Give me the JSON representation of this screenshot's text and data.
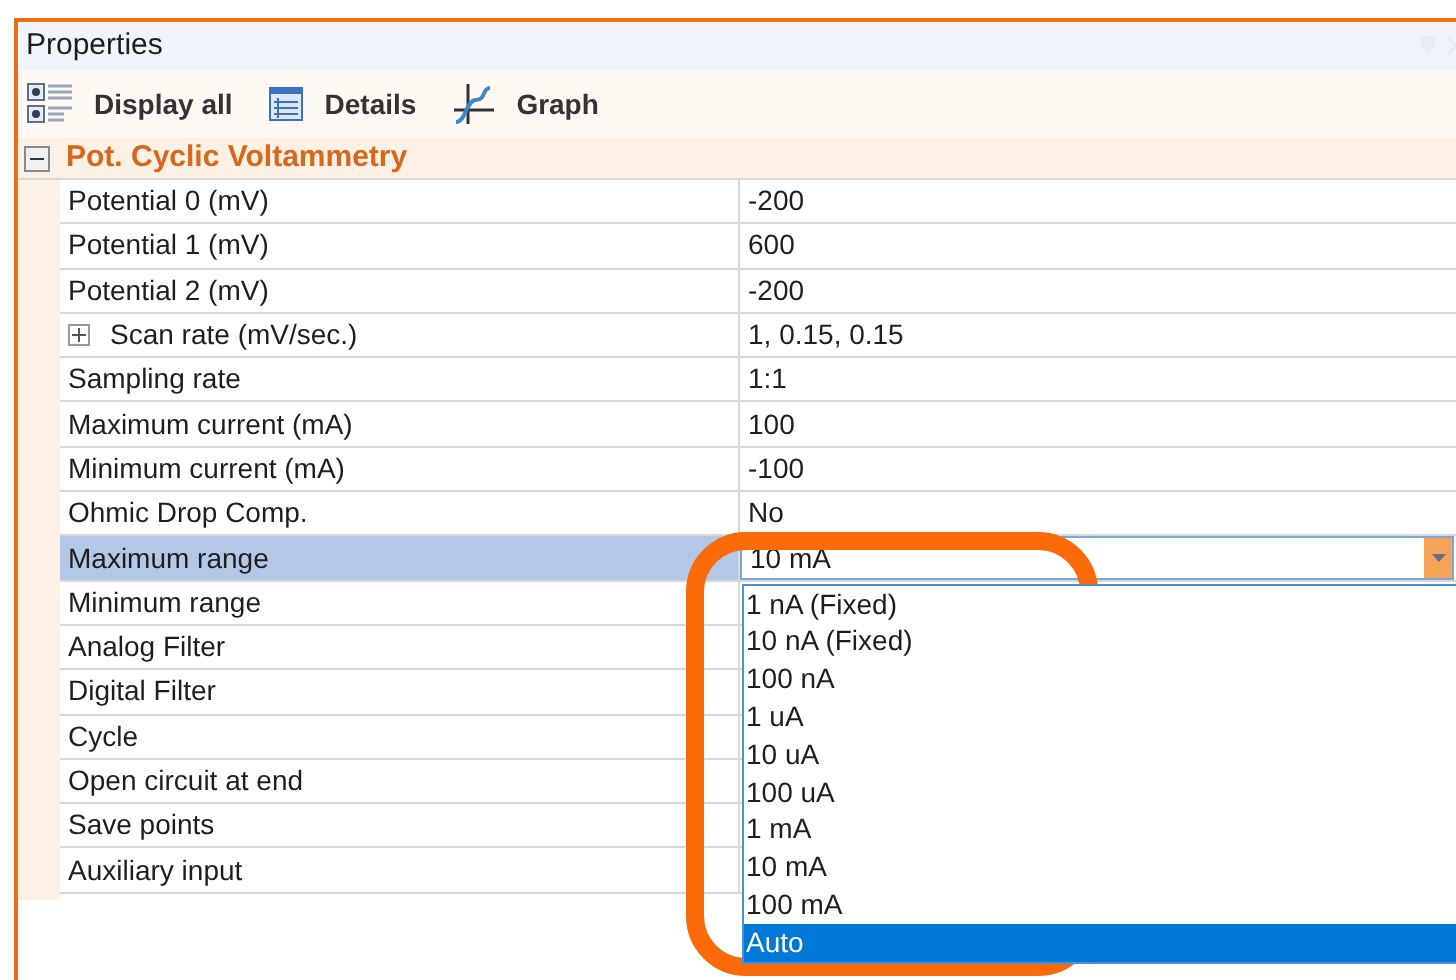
{
  "window": {
    "title": "Properties"
  },
  "toolbar": [
    {
      "label": "Display all",
      "kind": "display"
    },
    {
      "label": "Details",
      "kind": "details"
    },
    {
      "label": "Graph",
      "kind": "graph"
    }
  ],
  "group": {
    "title": "Pot. Cyclic Voltammetry",
    "expanded": true
  },
  "rows": [
    {
      "label": "Potential 0 (mV)",
      "value": "-200",
      "selected": false
    },
    {
      "label": "Potential 1 (mV)",
      "value": "600",
      "selected": false
    },
    {
      "label": "Potential 2 (mV)",
      "value": "-200",
      "selected": false
    },
    {
      "label": "Scan rate (mV/sec.)",
      "value": "1, 0.15, 0.15",
      "selected": false,
      "expandable": true
    },
    {
      "label": "Sampling rate",
      "value": "1:1",
      "selected": false
    },
    {
      "label": "Maximum current (mA)",
      "value": "100",
      "selected": false
    },
    {
      "label": "Minimum current (mA)",
      "value": "-100",
      "selected": false
    },
    {
      "label": "Ohmic Drop Comp.",
      "value": "No",
      "selected": false
    },
    {
      "label": "Maximum range",
      "value": "10 mA",
      "selected": true,
      "dropdown_open": true
    },
    {
      "label": "Minimum range",
      "selected": false
    },
    {
      "label": "Analog Filter",
      "selected": false
    },
    {
      "label": "Digital Filter",
      "selected": false
    },
    {
      "label": "Cycle",
      "selected": false
    },
    {
      "label": "Open circuit at end",
      "selected": false
    },
    {
      "label": "Save points",
      "selected": false
    },
    {
      "label": "Auxiliary input",
      "selected": false
    }
  ],
  "dropdown_options": [
    {
      "label": "1 nA (Fixed)",
      "selected": false
    },
    {
      "label": "10 nA (Fixed)",
      "selected": false
    },
    {
      "label": "100 nA",
      "selected": false
    },
    {
      "label": "1 uA",
      "selected": false
    },
    {
      "label": "10 uA",
      "selected": false
    },
    {
      "label": "100 uA",
      "selected": false
    },
    {
      "label": "1 mA",
      "selected": false
    },
    {
      "label": "10 mA",
      "selected": false
    },
    {
      "label": "100 mA",
      "selected": false
    },
    {
      "label": "Auto",
      "selected": true
    }
  ]
}
